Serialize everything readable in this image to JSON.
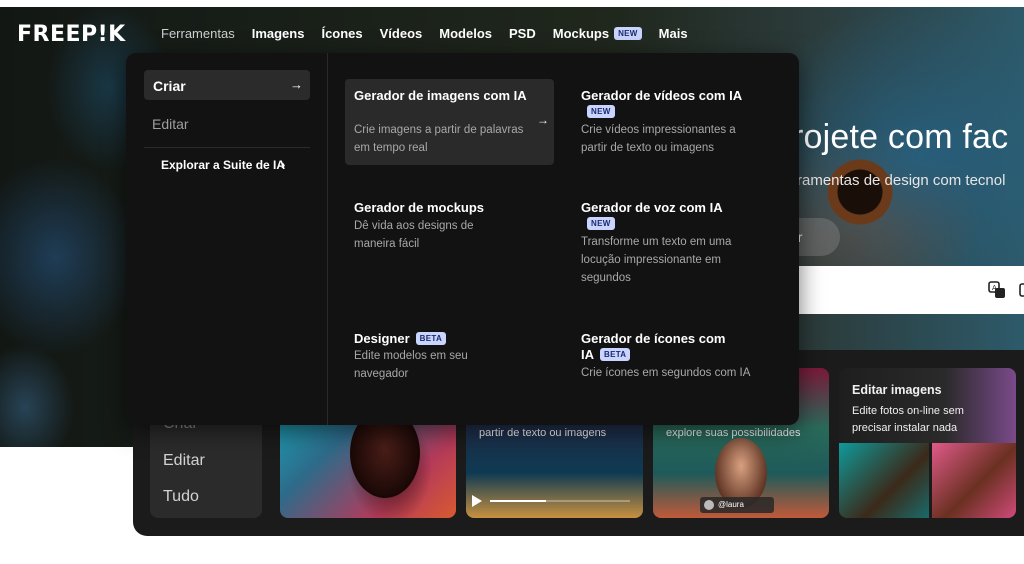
{
  "brand": {
    "logo_text": "FREEP!K"
  },
  "nav": {
    "items": [
      {
        "label": "Ferramentas"
      },
      {
        "label": "Imagens"
      },
      {
        "label": "Ícones"
      },
      {
        "label": "Vídeos"
      },
      {
        "label": "Modelos"
      },
      {
        "label": "PSD"
      },
      {
        "label": "Mockups",
        "badge": "NEW"
      },
      {
        "label": "Mais"
      }
    ]
  },
  "hero": {
    "title": "rojete com fac",
    "subtitle": "rramentas de design com tecnol",
    "pill_label": "ar"
  },
  "dropdown": {
    "left": {
      "active_label": "Criar",
      "active_arrow": "→",
      "secondary_label": "Editar",
      "explore_label": "Explorar a Suite de IA",
      "explore_chevron": "›"
    },
    "items": [
      {
        "title": "Gerador de imagens com IA",
        "badge": "",
        "desc": "Crie imagens a partir de palavras em tempo real",
        "arrow": "→"
      },
      {
        "title": "Gerador de vídeos com IA",
        "badge": "NEW",
        "desc": "Crie vídeos impressionantes a partir de texto ou imagens"
      },
      {
        "title": "Gerador de mockups",
        "badge": "",
        "desc": "Dê vida aos designs de maneira fácil"
      },
      {
        "title": "Gerador de voz com IA",
        "badge": "NEW",
        "desc": "Transforme um texto em uma locução impressionante em segundos"
      },
      {
        "title": "Designer",
        "badge": "BETA",
        "desc": "Edite modelos em seu navegador"
      },
      {
        "title": "Gerador de ícones com IA",
        "badge": "BETA",
        "desc": "Crie ícones em segundos com IA"
      }
    ]
  },
  "lower": {
    "menu": [
      {
        "label": "Criar"
      },
      {
        "label": "Editar"
      },
      {
        "label": "Tudo"
      }
    ],
    "cards": {
      "video_caption": "partir de texto ou imagens",
      "explore_caption": "explore suas possibilidades",
      "user_handle": "@laura",
      "edit_title": "Editar imagens",
      "edit_desc_1": "Edite fotos on-line sem",
      "edit_desc_2": "precisar instalar nada"
    }
  }
}
